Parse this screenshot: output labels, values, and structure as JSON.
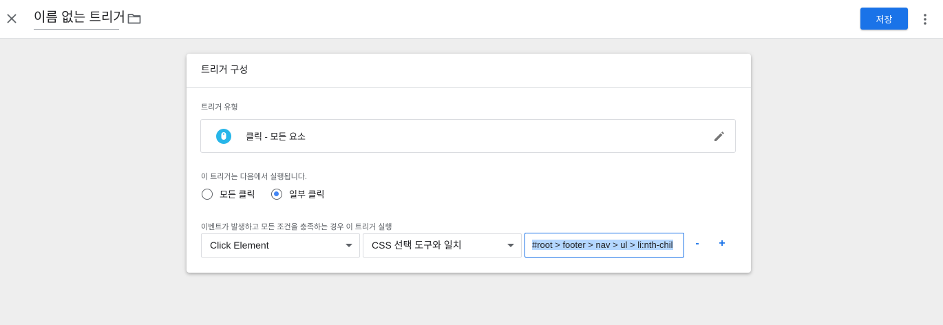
{
  "header": {
    "title": "이름 없는 트리거",
    "save_label": "저장",
    "icons": {
      "close": "close-icon",
      "folder": "folder-icon",
      "more": "more-vert-icon"
    }
  },
  "card": {
    "title": "트리거 구성",
    "trigger_type": {
      "section_label": "트리거 유형",
      "value": "클릭 - 모든 요소",
      "icon": "mouse-icon",
      "icon_color": "#27b6e9",
      "edit_icon": "pencil-icon"
    },
    "fire_on": {
      "section_label": "이 트리거는 다음에서 실행됩니다.",
      "options": [
        {
          "label": "모든 클릭",
          "checked": false
        },
        {
          "label": "일부 클릭",
          "checked": true
        }
      ]
    },
    "condition": {
      "section_label": "이벤트가 발생하고 모든 조건을 충족하는 경우 이 트리거 실행",
      "variable": "Click Element",
      "operator": "CSS 선택 도구와 일치",
      "value": "#root > footer > nav > ul > li:nth-chil",
      "remove_label": "-",
      "add_label": "+"
    }
  },
  "colors": {
    "accent": "#1a73e8",
    "background": "#eeeeee"
  }
}
